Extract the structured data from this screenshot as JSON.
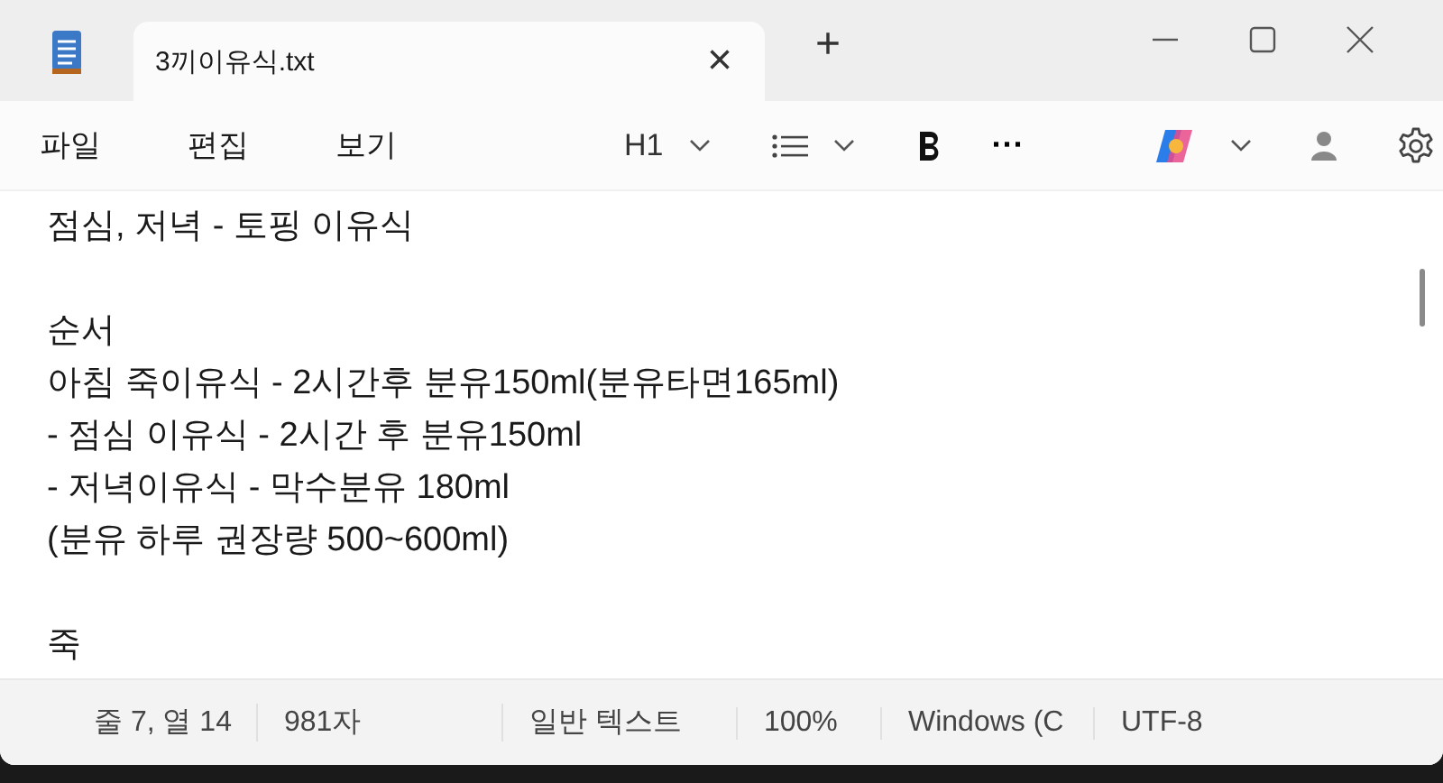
{
  "tab": {
    "title": "3끼이유식.txt",
    "close": "×",
    "new_tab": "+"
  },
  "menu": [
    "파일",
    "편집",
    "보기"
  ],
  "toolbar": {
    "heading": "H1",
    "more": "···"
  },
  "paragraphs": [
    [
      "점심, 저녁 - 토핑 이유식"
    ],
    [
      "순서",
      "아침 죽이유식 - 2시간후 분유150ml(분유타면165ml)",
      "- 점심 이유식 - 2시간 후 분유150ml",
      "- 저녁이유식 - 막수분유 180ml",
      "(분유 하루 권장량 500~600ml)"
    ],
    [
      "죽"
    ]
  ],
  "status_bar": [
    "줄 7, 열 14",
    "981자",
    "일반 텍스트",
    "100%",
    "Windows (C",
    "UTF-8"
  ]
}
